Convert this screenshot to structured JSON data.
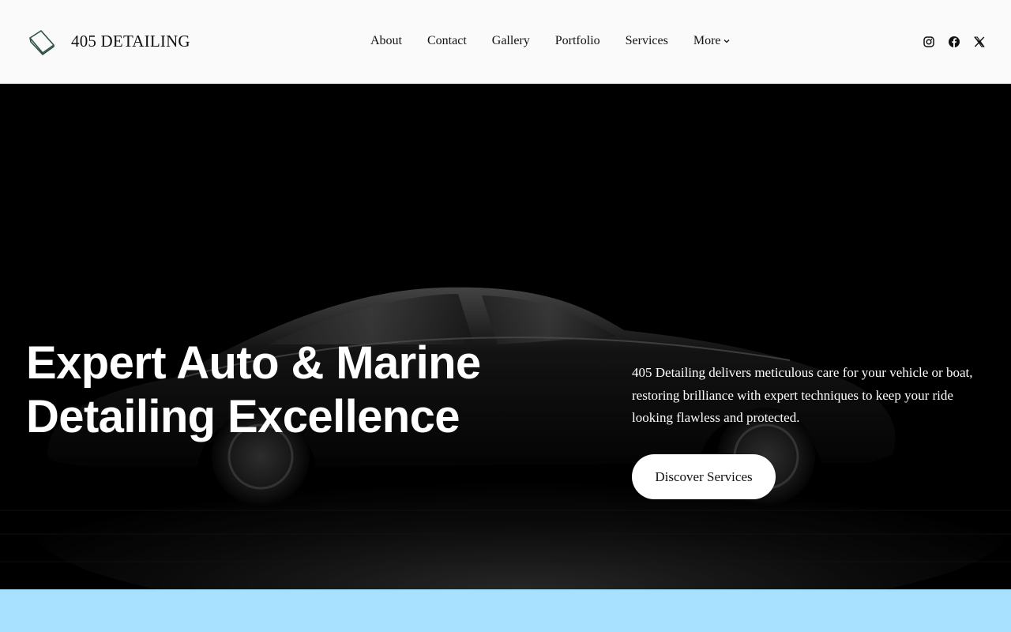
{
  "site": {
    "brand": "405 DETAILING",
    "nav": [
      {
        "label": "About"
      },
      {
        "label": "Contact"
      },
      {
        "label": "Gallery"
      },
      {
        "label": "Portfolio"
      },
      {
        "label": "Services"
      },
      {
        "label": "More"
      }
    ],
    "social": [
      "instagram-icon",
      "facebook-icon",
      "x-icon"
    ]
  },
  "hero": {
    "title_line1": "Expert Auto & Marine",
    "title_line2": "Detailing Excellence",
    "description": "405 Detailing delivers meticulous care for your vehicle or boat, restoring brilliance with expert techniques to keep your ride looking flawless and protected.",
    "cta_label": "Discover Services"
  },
  "colors": {
    "header_bg": "#fafafa",
    "hero_bg": "#000000",
    "band_bg": "#a8e0ff",
    "cta_bg": "#ffffff",
    "text_light": "#ffffff",
    "text_dark": "#111111"
  }
}
